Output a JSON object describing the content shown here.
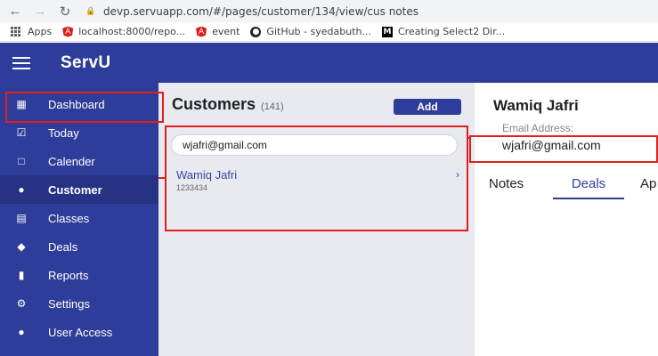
{
  "browser": {
    "url": "devp.servuapp.com/#/pages/customer/134/view/cus notes",
    "bookmarks": [
      {
        "label": "Apps",
        "icon": "apps-grid-icon"
      },
      {
        "label": "localhost:8000/repo...",
        "icon": "angular-icon",
        "color": "#dd1b16"
      },
      {
        "label": "event",
        "icon": "angular-icon",
        "color": "#dd1b16"
      },
      {
        "label": "GitHub - syedabuth...",
        "icon": "github-icon",
        "color": "#222222"
      },
      {
        "label": "Creating Select2 Dir...",
        "icon": "medium-icon",
        "color": "#000000"
      }
    ]
  },
  "app": {
    "brand": "ServU",
    "primary_color": "#2f3d9a"
  },
  "sidebar": {
    "items": [
      {
        "label": "Dashboard",
        "icon": "bar-chart-icon"
      },
      {
        "label": "Today",
        "icon": "calendar-check-icon"
      },
      {
        "label": "Calender",
        "icon": "calendar-icon"
      },
      {
        "label": "Customer",
        "icon": "user-icon",
        "active": true
      },
      {
        "label": "Classes",
        "icon": "book-icon"
      },
      {
        "label": "Deals",
        "icon": "tag-icon"
      },
      {
        "label": "Reports",
        "icon": "file-icon"
      },
      {
        "label": "Settings",
        "icon": "cogs-icon"
      },
      {
        "label": "User Access",
        "icon": "users-icon"
      }
    ]
  },
  "customers": {
    "title": "Customers",
    "count": "(141)",
    "add_label": "Add",
    "search_value": "wjafri@gmail.com",
    "list": [
      {
        "name": "Wamiq Jafri",
        "phone": "1233434"
      }
    ]
  },
  "detail": {
    "name": "Wamiq Jafri",
    "email_label": "Email Address:",
    "email": "wjafri@gmail.com",
    "tabs": [
      {
        "label": "Notes"
      },
      {
        "label": "Deals",
        "active": true
      },
      {
        "label": "Ap"
      }
    ]
  }
}
